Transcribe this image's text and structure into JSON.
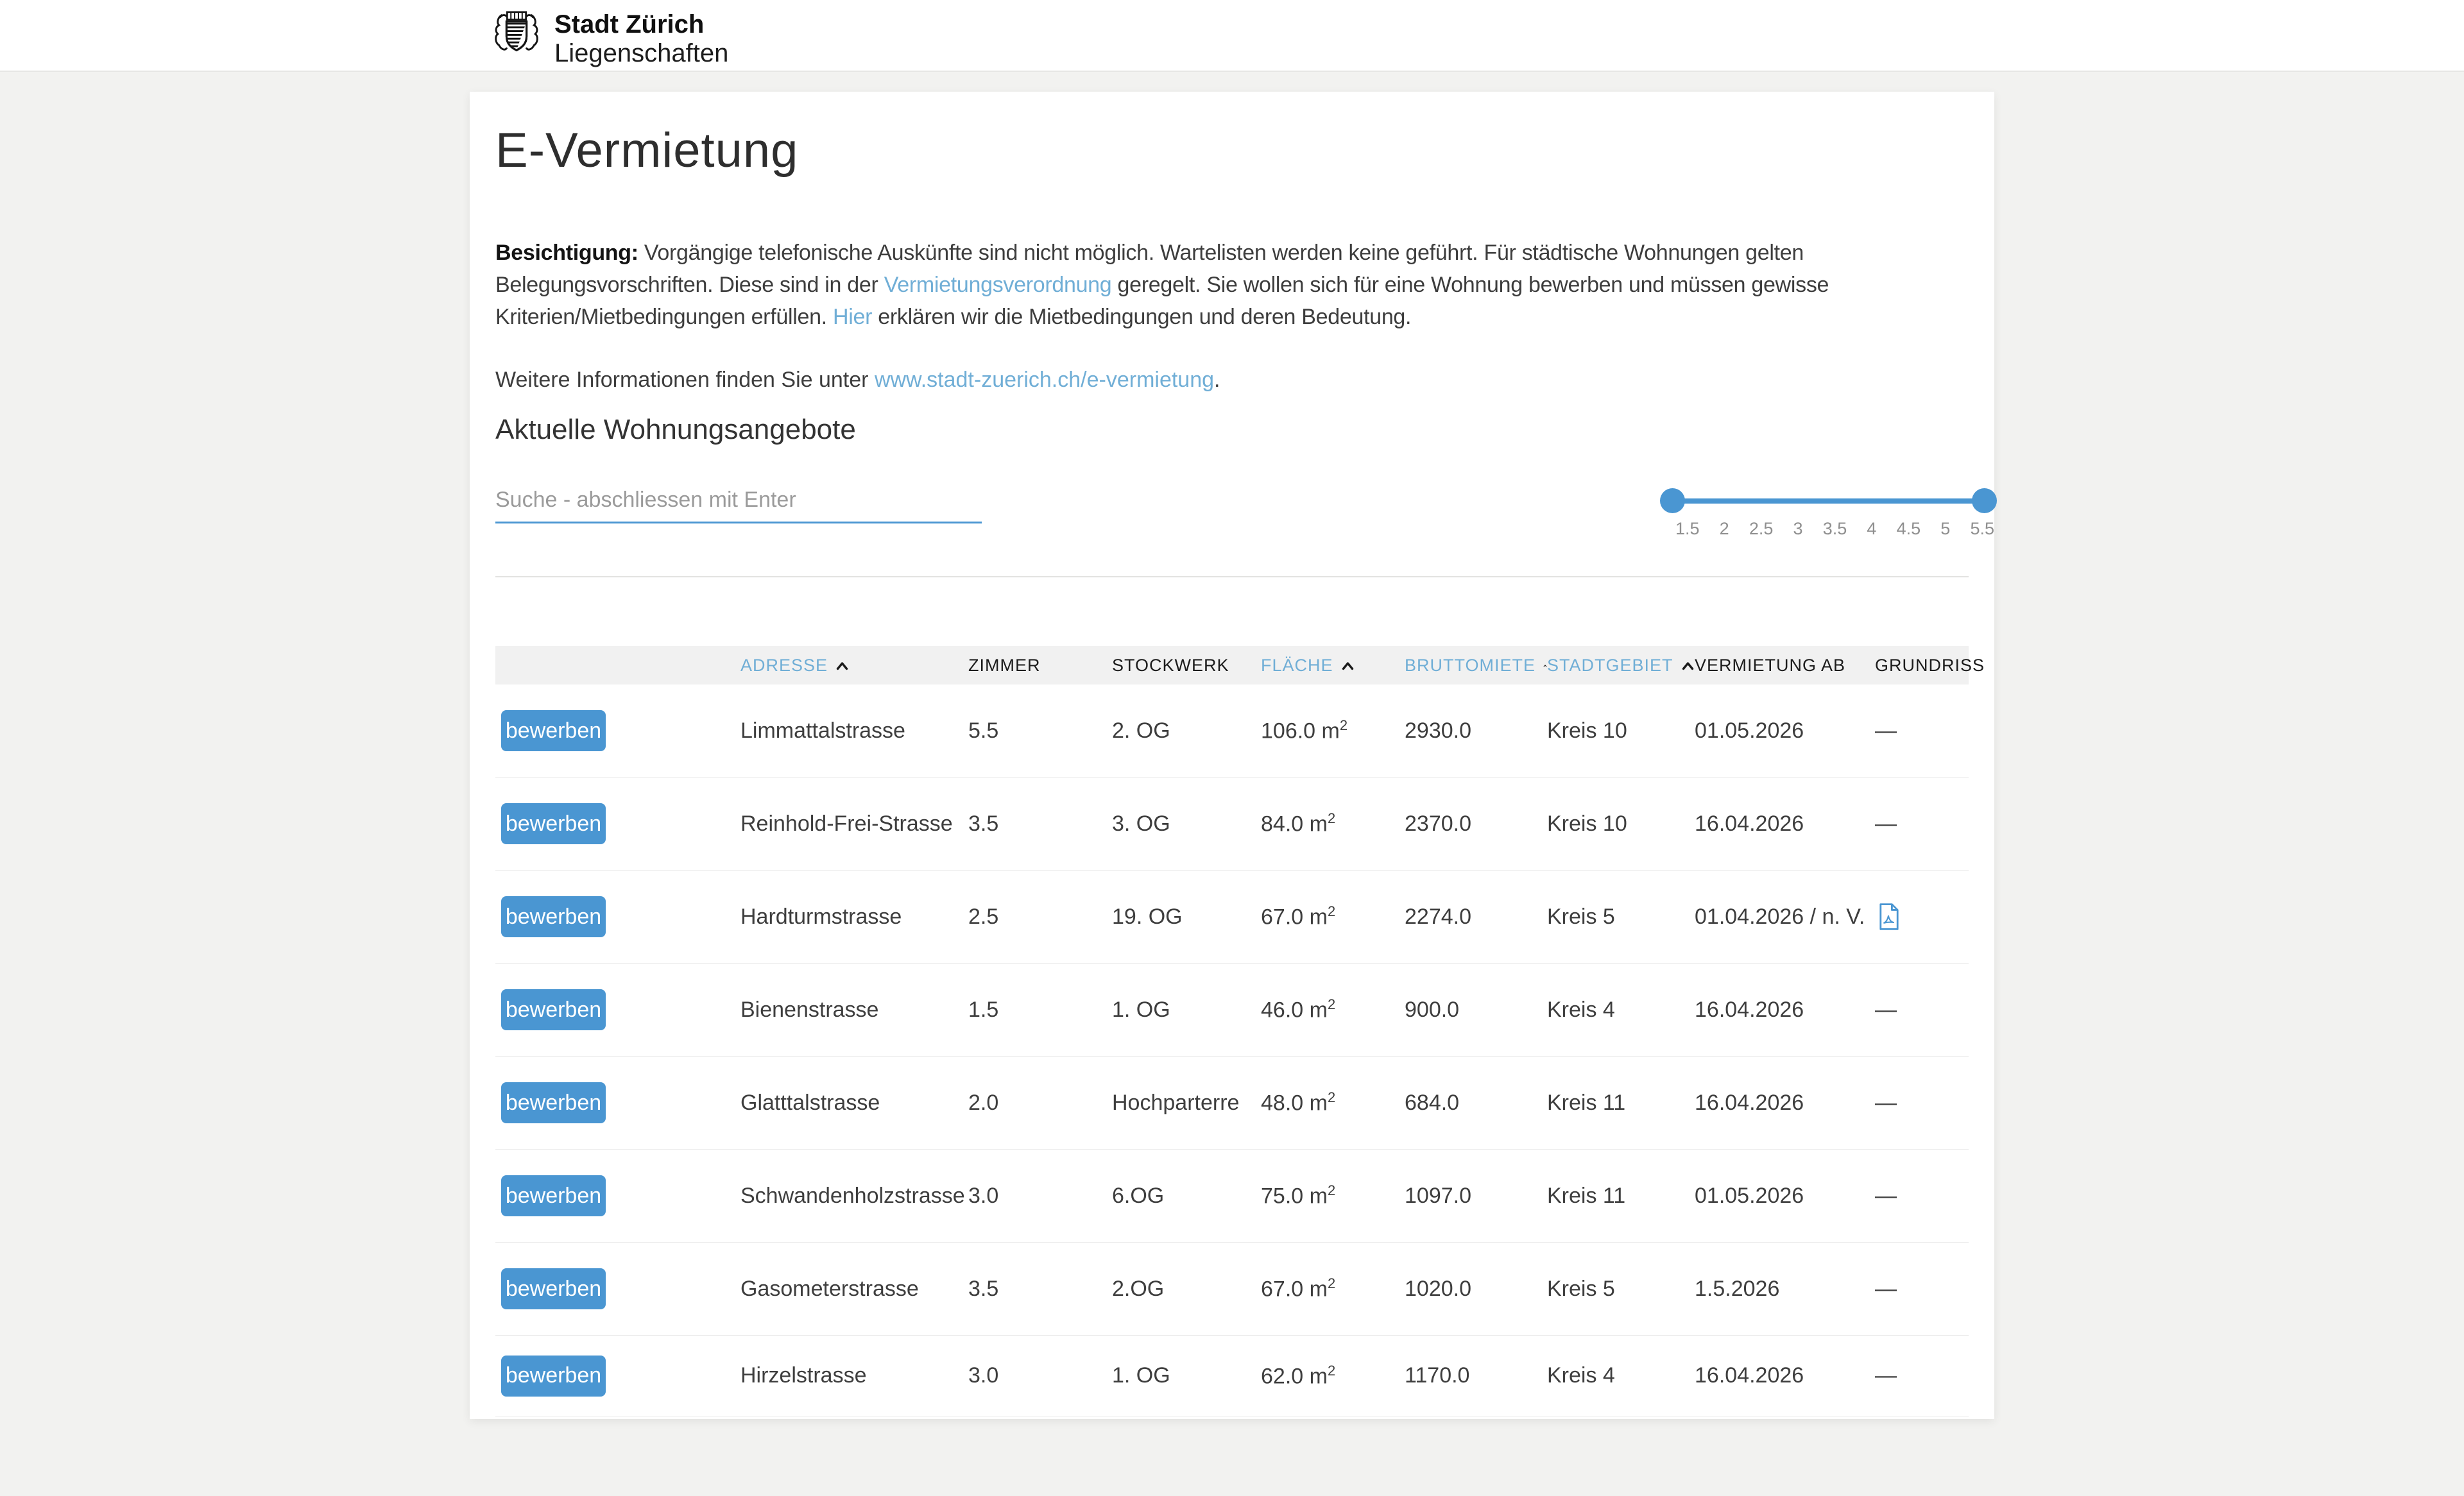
{
  "header": {
    "brand_top": "Stadt Zürich",
    "brand_bottom": "Liegenschaften"
  },
  "page": {
    "title": "E-Vermietung",
    "intro_bold": "Besichtigung:",
    "intro_part1": " Vorgängige telefonische Auskünfte sind nicht möglich. Wartelisten werden keine geführt. Für städtische Wohnungen gelten Belegungsvorschriften. Diese sind in der ",
    "intro_link1": "Vermietungsverordnung",
    "intro_part2": " geregelt. Sie wollen sich für eine Wohnung bewerben und müssen gewisse Kriterien/Mietbedingungen erfüllen. ",
    "intro_link2": "Hier",
    "intro_part3": " erklären wir die Mietbedingungen und deren Bedeutung.",
    "more_info_text": "Weitere Informationen finden Sie unter ",
    "more_info_link": "www.stadt-zuerich.ch/e-vermietung",
    "more_info_suffix": ".",
    "section_heading": "Aktuelle Wohnungsangebote"
  },
  "search": {
    "placeholder": "Suche - abschliessen mit Enter"
  },
  "slider": {
    "labels": [
      "1.5",
      "2",
      "2.5",
      "3",
      "3.5",
      "4",
      "4.5",
      "5",
      "5.5"
    ],
    "selected_min": "1.5",
    "selected_max": "5.5"
  },
  "table": {
    "apply_label": "bewerben",
    "columns": [
      {
        "key": "adresse",
        "label": "ADRESSE",
        "sortable": true
      },
      {
        "key": "zimmer",
        "label": "ZIMMER",
        "sortable": false
      },
      {
        "key": "stockwerk",
        "label": "STOCKWERK",
        "sortable": false
      },
      {
        "key": "flaeche",
        "label": "FLÄCHE",
        "sortable": true
      },
      {
        "key": "bruttomiete",
        "label": "BRUTTOMIETE",
        "sortable": true
      },
      {
        "key": "stadtgebiet",
        "label": "STADTGEBIET",
        "sortable": true
      },
      {
        "key": "vermietung_ab",
        "label": "VERMIETUNG AB",
        "sortable": false
      },
      {
        "key": "grundriss",
        "label": "GRUNDRISS",
        "sortable": false
      }
    ],
    "rows": [
      {
        "adresse": "Limmattalstrasse",
        "zimmer": "5.5",
        "stockwerk": "2. OG",
        "flaeche": "106.0 m",
        "flaeche_sup": "2",
        "bruttomiete": "2930.0",
        "stadtgebiet": "Kreis 10",
        "vermietung_ab": "01.05.2026",
        "grundriss": "—",
        "grundriss_pdf": false
      },
      {
        "adresse": "Reinhold-Frei-Strasse",
        "zimmer": "3.5",
        "stockwerk": "3. OG",
        "flaeche": "84.0 m",
        "flaeche_sup": "2",
        "bruttomiete": "2370.0",
        "stadtgebiet": "Kreis 10",
        "vermietung_ab": "16.04.2026",
        "grundriss": "—",
        "grundriss_pdf": false
      },
      {
        "adresse": "Hardturmstrasse",
        "zimmer": "2.5",
        "stockwerk": "19. OG",
        "flaeche": "67.0 m",
        "flaeche_sup": "2",
        "bruttomiete": "2274.0",
        "stadtgebiet": "Kreis 5",
        "vermietung_ab": "01.04.2026 / n. V.",
        "grundriss": "",
        "grundriss_pdf": true
      },
      {
        "adresse": "Bienenstrasse",
        "zimmer": "1.5",
        "stockwerk": "1. OG",
        "flaeche": "46.0 m",
        "flaeche_sup": "2",
        "bruttomiete": "900.0",
        "stadtgebiet": "Kreis 4",
        "vermietung_ab": "16.04.2026",
        "grundriss": "—",
        "grundriss_pdf": false
      },
      {
        "adresse": "Glatttalstrasse",
        "zimmer": "2.0",
        "stockwerk": "Hochparterre",
        "flaeche": "48.0 m",
        "flaeche_sup": "2",
        "bruttomiete": "684.0",
        "stadtgebiet": "Kreis 11",
        "vermietung_ab": "16.04.2026",
        "grundriss": "—",
        "grundriss_pdf": false
      },
      {
        "adresse": "Schwandenholzstrasse",
        "zimmer": "3.0",
        "stockwerk": "6.OG",
        "flaeche": "75.0 m",
        "flaeche_sup": "2",
        "bruttomiete": "1097.0",
        "stadtgebiet": "Kreis 11",
        "vermietung_ab": "01.05.2026",
        "grundriss": "—",
        "grundriss_pdf": false
      },
      {
        "adresse": "Gasometerstrasse",
        "zimmer": "3.5",
        "stockwerk": "2.OG",
        "flaeche": "67.0 m",
        "flaeche_sup": "2",
        "bruttomiete": "1020.0",
        "stadtgebiet": "Kreis 5",
        "vermietung_ab": "1.5.2026",
        "grundriss": "—",
        "grundriss_pdf": false
      },
      {
        "adresse": "Hirzelstrasse",
        "zimmer": "3.0",
        "stockwerk": "1. OG",
        "flaeche": "62.0 m",
        "flaeche_sup": "2",
        "bruttomiete": "1170.0",
        "stadtgebiet": "Kreis 4",
        "vermietung_ab": "16.04.2026",
        "grundriss": "—",
        "grundriss_pdf": false
      }
    ]
  },
  "colors": {
    "accent_blue": "#4a96d2",
    "link_blue": "#70aed6",
    "page_background": "#f2f2f0",
    "table_header_background": "#f1f1f1"
  }
}
